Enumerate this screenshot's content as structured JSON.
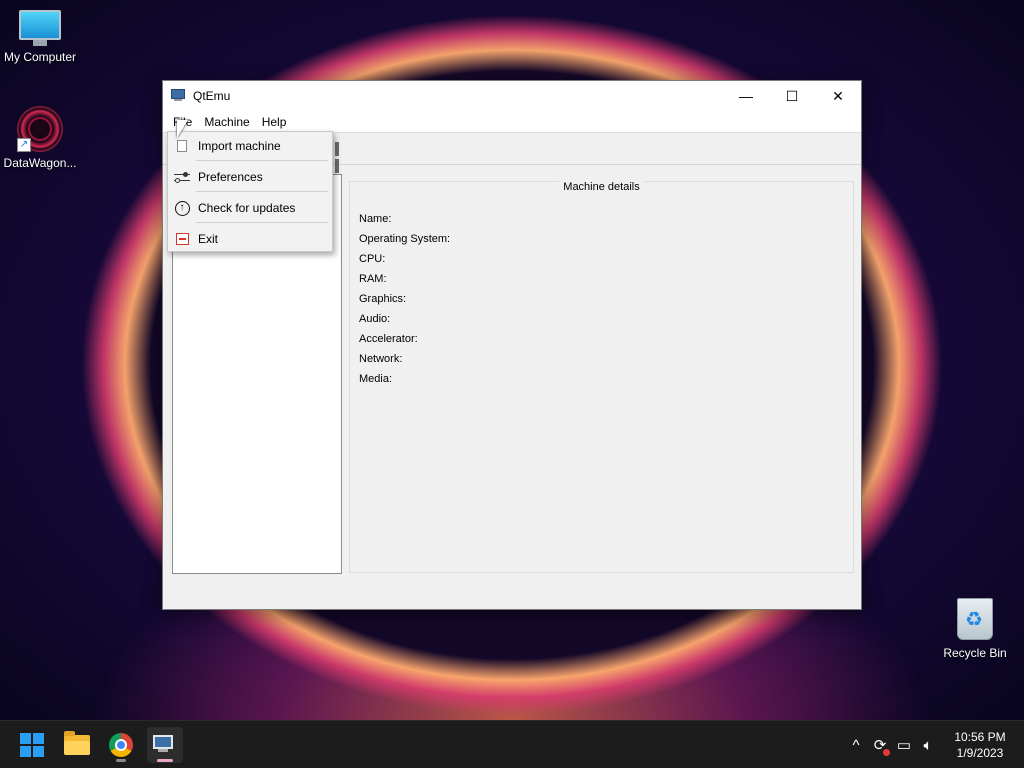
{
  "desktop": {
    "icons": [
      {
        "label": "My Computer",
        "icon": "monitor-icon"
      },
      {
        "label": "DataWagon...",
        "icon": "datawagon-icon"
      },
      {
        "label": "Recycle Bin",
        "icon": "recycle-bin-icon"
      }
    ]
  },
  "window": {
    "title": "QtEmu",
    "controls": {
      "minimize": "—",
      "maximize": "☐",
      "close": "✕"
    },
    "menubar": [
      "File",
      "Machine",
      "Help"
    ],
    "details": {
      "title": "Machine details",
      "fields": [
        "Name:",
        "Operating System:",
        "CPU:",
        "RAM:",
        "Graphics:",
        "Audio:",
        "Accelerator:",
        "Network:",
        "Media:"
      ]
    }
  },
  "file_menu": {
    "items": [
      {
        "label": "Import machine",
        "icon": "import-icon"
      },
      {
        "label": "Preferences",
        "icon": "preferences-icon"
      },
      {
        "label": "Check for updates",
        "icon": "update-icon"
      },
      {
        "label": "Exit",
        "icon": "exit-icon"
      }
    ]
  },
  "taskbar": {
    "apps": [
      "start",
      "file-explorer",
      "chrome",
      "qtemu"
    ],
    "tray": {
      "chevron": "^",
      "time": "10:56 PM",
      "date": "1/9/2023"
    }
  },
  "colors": {
    "taskbar": "#1c1c1c",
    "window_bg": "#f0f0f0",
    "accent": "#2a9df4"
  }
}
